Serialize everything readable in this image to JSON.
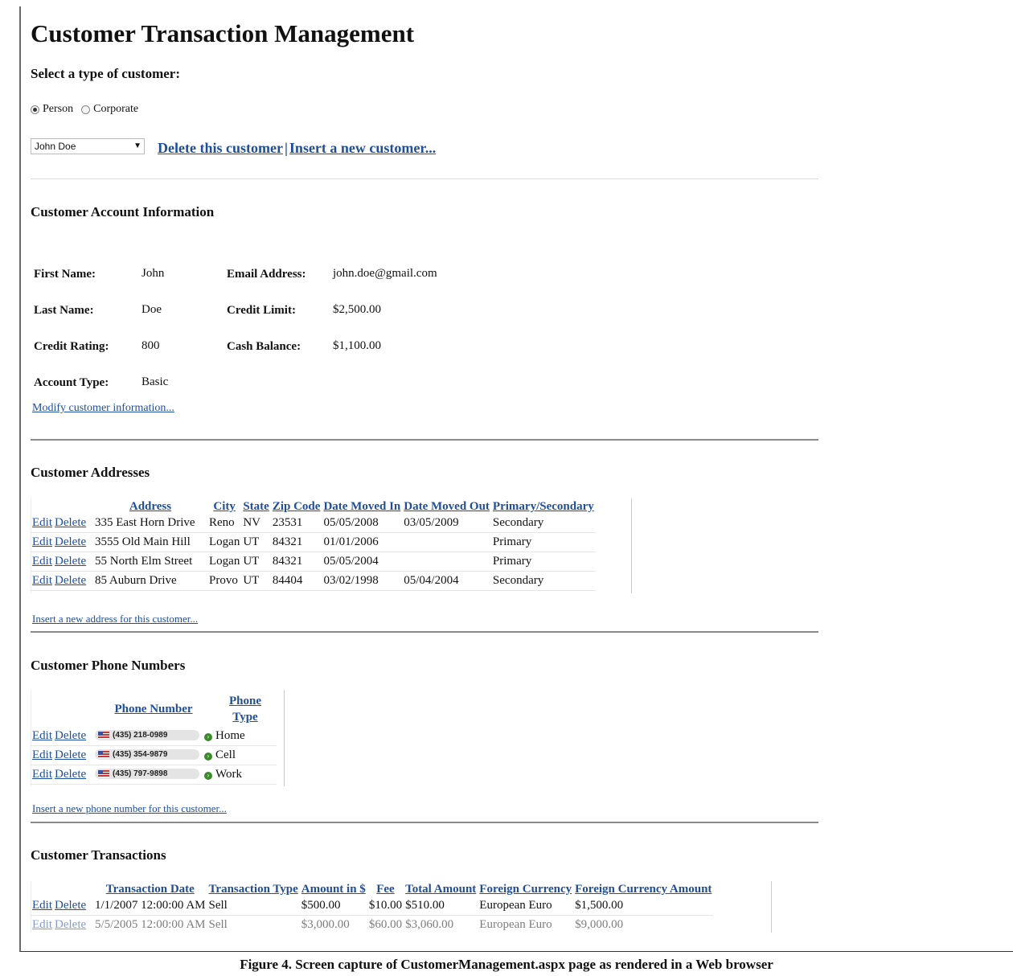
{
  "title": "Customer Transaction Management",
  "select_type_label": "Select a type of customer:",
  "radios": [
    {
      "label": "Person",
      "checked": true
    },
    {
      "label": "Corporate",
      "checked": false
    }
  ],
  "customer_select": {
    "value": "John Doe"
  },
  "links": {
    "delete_customer": "Delete this customer",
    "separator": "|",
    "insert_customer": "Insert a new customer..."
  },
  "account": {
    "heading": "Customer Account Information",
    "rows": [
      {
        "l1": "First Name:",
        "v1": "John",
        "l2": "Email Address:",
        "v2": "john.doe@gmail.com"
      },
      {
        "l1": "Last Name:",
        "v1": "Doe",
        "l2": "Credit Limit:",
        "v2": "$2,500.00"
      },
      {
        "l1": "Credit Rating:",
        "v1": "800",
        "l2": "Cash Balance:",
        "v2": "$1,100.00"
      },
      {
        "l1": "Account Type:",
        "v1": "Basic",
        "l2": "",
        "v2": ""
      }
    ],
    "modify_link": "Modify customer information..."
  },
  "addresses": {
    "heading": "Customer Addresses",
    "columns": [
      "Address",
      "City",
      "State",
      "Zip Code",
      "Date Moved In",
      "Date Moved Out",
      "Primary/Secondary"
    ],
    "edit": "Edit",
    "delete": "Delete",
    "rows": [
      [
        "335 East Horn Drive",
        "Reno",
        "NV",
        "23531",
        "05/05/2008",
        "03/05/2009",
        "Secondary"
      ],
      [
        "3555 Old Main Hill",
        "Logan",
        "UT",
        "84321",
        "01/01/2006",
        "",
        "Primary"
      ],
      [
        "55 North Elm Street",
        "Logan",
        "UT",
        "84321",
        "05/05/2004",
        "",
        "Primary"
      ],
      [
        "85 Auburn Drive",
        "Provo",
        "UT",
        "84404",
        "03/02/1998",
        "05/04/2004",
        "Secondary"
      ]
    ],
    "insert_link": "Insert a new address for this customer..."
  },
  "phones": {
    "heading": "Customer Phone Numbers",
    "columns": [
      "Phone Number",
      "Phone Type"
    ],
    "edit": "Edit",
    "delete": "Delete",
    "rows": [
      [
        "(435) 218-0989",
        "Home"
      ],
      [
        "(435) 354-9879",
        "Cell"
      ],
      [
        "(435) 797-9898",
        "Work"
      ]
    ],
    "insert_link": "Insert a new phone number for this customer..."
  },
  "transactions": {
    "heading": "Customer Transactions",
    "columns": [
      "Transaction Date",
      "Transaction Type",
      "Amount in $",
      "Fee",
      "Total Amount",
      "Foreign Currency",
      "Foreign Currency Amount"
    ],
    "edit": "Edit",
    "delete": "Delete",
    "rows": [
      [
        "1/1/2007 12:00:00 AM",
        "Sell",
        "$500.00",
        "$10.00",
        "$510.00",
        "European Euro",
        "$1,500.00"
      ],
      [
        "5/5/2005 12:00:00 AM",
        "Sell",
        "$3,000.00",
        "$60.00",
        "$3,060.00",
        "European Euro",
        "$9,000.00"
      ]
    ]
  },
  "caption": "Figure 4.  Screen capture of CustomerManagement.aspx page as rendered in a Web browser"
}
